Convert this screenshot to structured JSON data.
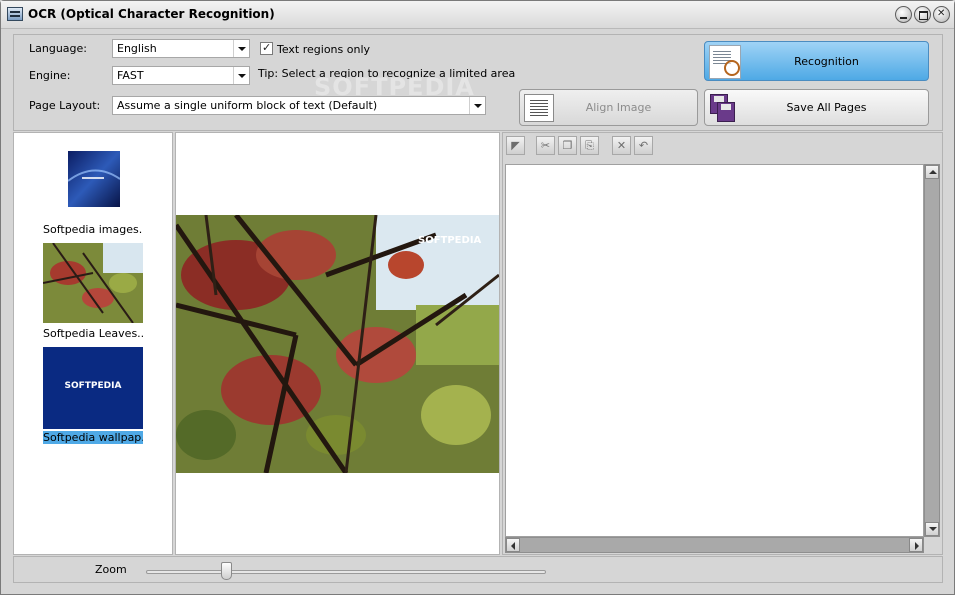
{
  "window": {
    "title": "OCR (Optical Character Recognition)"
  },
  "settings": {
    "language_label": "Language:",
    "language_value": "English",
    "engine_label": "Engine:",
    "engine_value": "FAST",
    "layout_label": "Page Layout:",
    "layout_value": "Assume a single uniform block of text (Default)",
    "text_regions_label": "Text regions only",
    "text_regions_checked": true,
    "tip": "Tip: Select a region to recognize a limited area"
  },
  "actions": {
    "recognition": "Recognition",
    "align_image": "Align Image",
    "save_all_pages": "Save All Pages"
  },
  "watermark": "SOFTPEDIA",
  "thumbnails": [
    {
      "label": "Softpedia images....",
      "selected": false
    },
    {
      "label": "Softpedia Leaves....",
      "selected": false
    },
    {
      "label": "Softpedia wallpap....",
      "selected": true,
      "logo": "SOFTPEDIA"
    }
  ],
  "preview": {
    "watermark": "SOFTPEDIA"
  },
  "text_toolbar": {
    "icons": [
      "first-page-icon",
      "cut-icon",
      "copy-icon",
      "paste-icon",
      "delete-icon",
      "undo-icon"
    ]
  },
  "zoom": {
    "label": "Zoom",
    "level": 0.2
  }
}
